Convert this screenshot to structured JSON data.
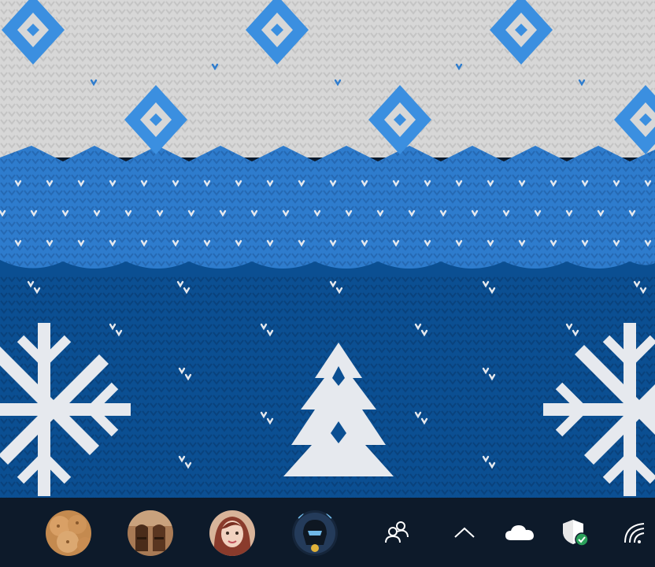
{
  "window": {
    "type": "desktop",
    "wallpaper": "knitted-sweater-pattern"
  },
  "colors": {
    "knit_light": "#d9d9d9",
    "knit_mid_blue": "#2f7ed0",
    "knit_dark_blue": "#0b4f92",
    "knit_white_stitch": "#e6e9ee",
    "taskbar_bg": "#0d1a2a",
    "tray_icon": "#ffffff",
    "defender_check": "#2aa05a"
  },
  "taskbar": {
    "people_pins": [
      {
        "name": "contact-cookies",
        "avatar": "cookies-photo"
      },
      {
        "name": "contact-boots",
        "avatar": "boots-photo"
      },
      {
        "name": "contact-woman",
        "avatar": "portrait-photo"
      },
      {
        "name": "contact-helmet",
        "avatar": "helmet-photo"
      }
    ],
    "tray": [
      {
        "name": "people-button",
        "icon": "people-icon"
      },
      {
        "name": "show-hidden-icons-button",
        "icon": "chevron-up-icon"
      },
      {
        "name": "onedrive-button",
        "icon": "cloud-icon"
      },
      {
        "name": "defender-button",
        "icon": "shield-check-icon"
      },
      {
        "name": "network-button",
        "icon": "wifi-icon"
      }
    ]
  }
}
